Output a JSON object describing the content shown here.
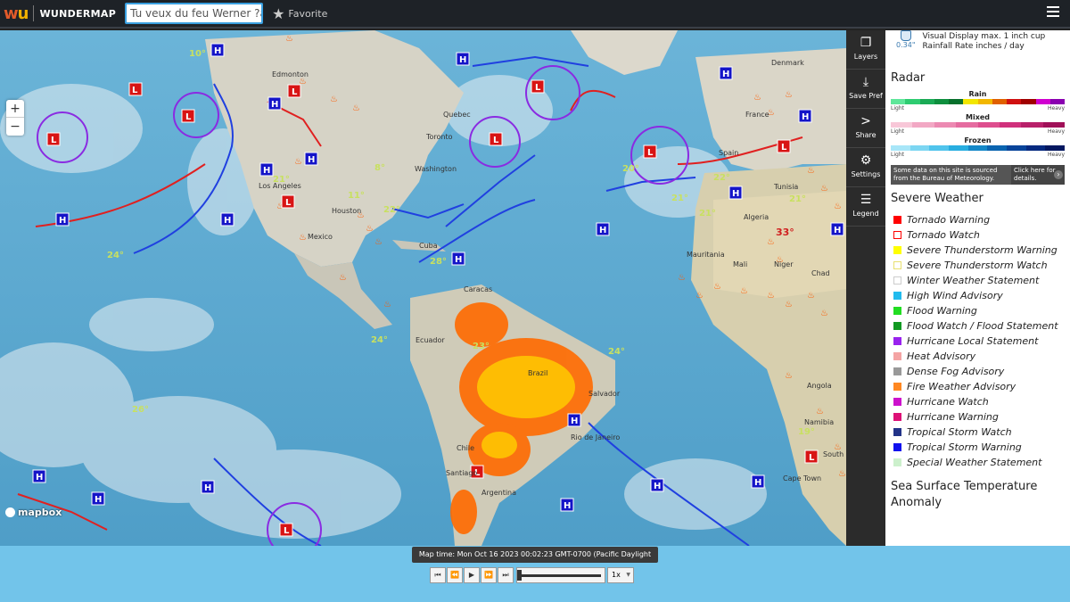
{
  "header": {
    "logo_text": "WUNDERMAP",
    "search_value": "Tu veux du feu Werner ?ai",
    "favorite_label": "Favorite"
  },
  "map": {
    "zoom_in": "+",
    "zoom_out": "−",
    "attribution": "mapbox",
    "labels": [
      "Edmonton",
      "Denmark",
      "France",
      "Spain",
      "Algeria",
      "Tunisia",
      "Mexico",
      "Cuba",
      "Mauritania",
      "Mali",
      "Niger",
      "Chad",
      "Caracas",
      "Ecuador",
      "Brazil",
      "Salvador",
      "Rio de Janeiro",
      "Chile",
      "Santiago",
      "Argentina",
      "Angola",
      "Namibia",
      "Cape Town",
      "South",
      "Washington",
      "Quebec",
      "Toronto",
      "Los Angeles",
      "Houston",
      "Mapbox"
    ],
    "temps": [
      "10°",
      "8°",
      "21°",
      "11°",
      "24°",
      "26°",
      "28°",
      "24°",
      "23°",
      "23°",
      "26°",
      "21°",
      "22°",
      "20°",
      "33°",
      "22°",
      "25°",
      "24°",
      "21°",
      "19°",
      "6°",
      "20°"
    ]
  },
  "rail": [
    {
      "label": "Layers",
      "icon": "layers-icon"
    },
    {
      "label": "Save Pref",
      "icon": "save-icon"
    },
    {
      "label": "Share",
      "icon": "share-icon"
    },
    {
      "label": "Settings",
      "icon": "gear-icon"
    },
    {
      "label": "Legend",
      "icon": "list-icon"
    }
  ],
  "legend": {
    "rain_cup_value": "0.34\"",
    "rain_cup_text": "Visual Display max. 1 inch cup Rainfall Rate inches / day",
    "radar_title": "Radar",
    "rain_label": "Rain",
    "mixed_label": "Mixed",
    "frozen_label": "Frozen",
    "light_label": "Light",
    "heavy_label": "Heavy",
    "rain_colors": [
      "#5ee79a",
      "#2ecc71",
      "#1aaa55",
      "#0e8f3e",
      "#08702c",
      "#f2e600",
      "#f2b700",
      "#e06000",
      "#d01010",
      "#a00000",
      "#d000d0",
      "#8a00b0"
    ],
    "mixed_colors": [
      "#f8c7d8",
      "#f2a8c4",
      "#ec8ab2",
      "#e56ca0",
      "#de4e8e",
      "#d0307c",
      "#b8206a",
      "#a01058"
    ],
    "frozen_colors": [
      "#a8e6f8",
      "#7cd6f2",
      "#50c4ec",
      "#28aee0",
      "#1488c8",
      "#0a64b0",
      "#08449a",
      "#062a80",
      "#041860"
    ],
    "bom_text": "Some data on this site is sourced from the Bureau of Meteorology.",
    "bom_link": "Click here for details.",
    "severe_title": "Severe Weather",
    "severe_items": [
      {
        "label": "Tornado Warning",
        "color": "#ff0000",
        "outline": false
      },
      {
        "label": "Tornado Watch",
        "color": "#ff0000",
        "outline": true
      },
      {
        "label": "Severe Thunderstorm Warning",
        "color": "#ffff00",
        "outline": false
      },
      {
        "label": "Severe Thunderstorm Watch",
        "color": "#e8e070",
        "outline": true
      },
      {
        "label": "Winter Weather Statement",
        "color": "#cccccc",
        "outline": true
      },
      {
        "label": "High Wind Advisory",
        "color": "#22bbee",
        "outline": false
      },
      {
        "label": "Flood Warning",
        "color": "#22dd22",
        "outline": false
      },
      {
        "label": "Flood Watch / Flood Statement",
        "color": "#119922",
        "outline": false
      },
      {
        "label": "Hurricane Local Statement",
        "color": "#9922ee",
        "outline": false
      },
      {
        "label": "Heat Advisory",
        "color": "#f4a4a4",
        "outline": false
      },
      {
        "label": "Dense Fog Advisory",
        "color": "#999999",
        "outline": false
      },
      {
        "label": "Fire Weather Advisory",
        "color": "#ff8822",
        "outline": false
      },
      {
        "label": "Hurricane Watch",
        "color": "#cc11cc",
        "outline": false
      },
      {
        "label": "Hurricane Warning",
        "color": "#dd1177",
        "outline": false
      },
      {
        "label": "Tropical Storm Watch",
        "color": "#223388",
        "outline": false
      },
      {
        "label": "Tropical Storm Warning",
        "color": "#1111ee",
        "outline": false
      },
      {
        "label": "Special Weather Statement",
        "color": "#ccf0cc",
        "outline": false
      }
    ],
    "sst_title": "Sea Surface Temperature Anomaly"
  },
  "player": {
    "map_time": "Map time: Mon Oct 16 2023 00:02:23 GMT-0700 (Pacific Daylight Time)",
    "first": "⏮",
    "prev": "⏪",
    "play": "▶",
    "next": "⏩",
    "last": "⏭",
    "speed": "1x"
  }
}
